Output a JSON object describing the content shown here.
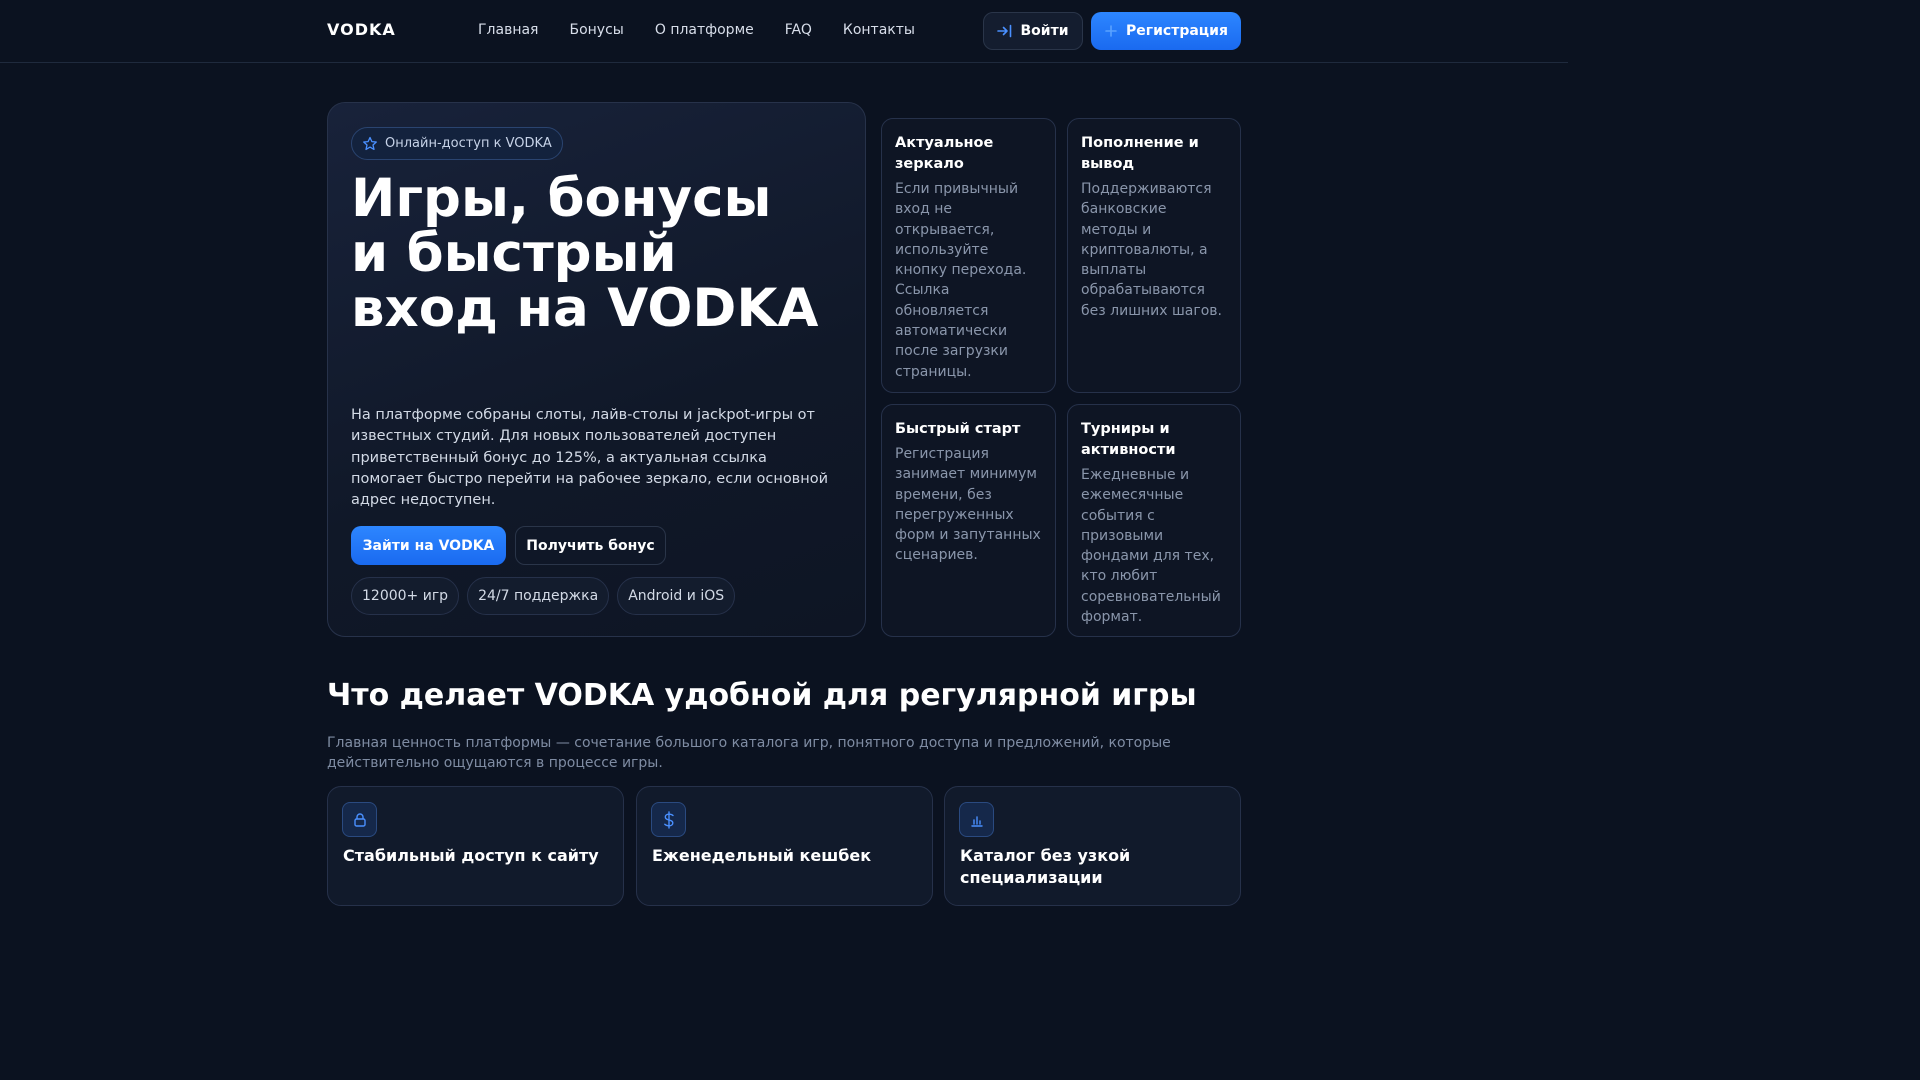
{
  "nav": {
    "logo": "VODKA",
    "items": [
      "Главная",
      "Бонусы",
      "О платформе",
      "FAQ",
      "Контакты"
    ],
    "login_label": "Войти",
    "register_label": "Регистрация"
  },
  "hero": {
    "badge": "Онлайн-доступ к VODKA",
    "title": "Игры, бонусы и быстрый вход на VODKA",
    "description": "На платформе собраны слоты, лайв-столы и jackpot-игры от известных студий. Для новых пользователей доступен приветственный бонус до 125%, а актуальная ссылка помогает быстро перейти на рабочее зеркало, если основной адрес недоступен.",
    "cta_primary": "Зайти на VODKA",
    "cta_secondary": "Получить бонус",
    "tags": [
      "12000+ игр",
      "24/7 поддержка",
      "Android и iOS"
    ]
  },
  "info_cards": [
    {
      "title": "Актуальное зеркало",
      "text": "Если привычный вход не открывается, используйте кнопку перехода. Ссылка обновляется автоматически после загрузки страницы."
    },
    {
      "title": "Пополнение и вывод",
      "text": "Поддерживаются банковские методы и криптовалюты, а выплаты обрабатываются без лишних шагов."
    },
    {
      "title": "Быстрый старт",
      "text": "Регистрация занимает минимум времени, без перегруженных форм и запутанных сценариев."
    },
    {
      "title": "Турниры и активности",
      "text": "Ежедневные и ежемесячные события с призовыми фондами для тех, кто любит соревновательный формат."
    }
  ],
  "section": {
    "title": "Что делает VODKA удобной для регулярной игры",
    "subtitle": "Главная ценность платформы — сочетание большого каталога игр, понятного доступа и предложений, которые действительно ощущаются в процессе игры."
  },
  "features": [
    {
      "icon": "lock-icon",
      "title": "Стабильный доступ к сайту"
    },
    {
      "icon": "dollar-icon",
      "title": "Еженедельный кешбек"
    },
    {
      "icon": "bar-chart-icon",
      "title": "Каталог без узкой специализации"
    }
  ],
  "colors": {
    "accent": "#2d86ff",
    "background": "#0b1220",
    "card": "#0e1524",
    "muted": "#8a96ab"
  }
}
